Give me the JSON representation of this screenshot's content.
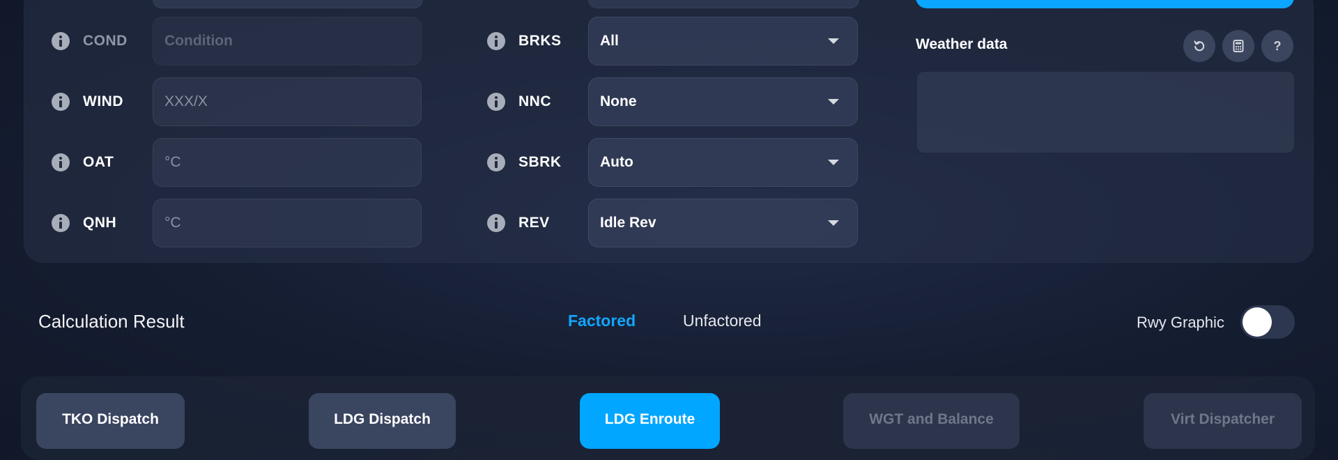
{
  "inputs": {
    "cond": {
      "label": "COND",
      "placeholder": "Condition"
    },
    "wind": {
      "label": "WIND",
      "placeholder": "XXX/X"
    },
    "oat": {
      "label": "OAT",
      "placeholder": "°C"
    },
    "qnh": {
      "label": "QNH",
      "placeholder": "°C"
    }
  },
  "selects": {
    "brks": {
      "label": "BRKS",
      "value": "All"
    },
    "nnc": {
      "label": "NNC",
      "value": "None"
    },
    "sbrk": {
      "label": "SBRK",
      "value": "Auto"
    },
    "rev": {
      "label": "REV",
      "value": "Idle Rev"
    }
  },
  "weather": {
    "title": "Weather data",
    "buttons": [
      "reset-icon",
      "calculator-icon",
      "help-icon"
    ],
    "help_glyph": "?"
  },
  "result": {
    "title": "Calculation Result",
    "tabs": [
      {
        "label": "Factored",
        "active": true
      },
      {
        "label": "Unfactored",
        "active": false
      }
    ],
    "rwy_graphic_label": "Rwy Graphic",
    "rwy_graphic_on": false
  },
  "nav": [
    {
      "label": "TKO Dispatch",
      "state": "normal"
    },
    {
      "label": "LDG Dispatch",
      "state": "normal"
    },
    {
      "label": "LDG Enroute",
      "state": "active"
    },
    {
      "label": "WGT and Balance",
      "state": "disabled"
    },
    {
      "label": "Virt Dispatcher",
      "state": "disabled"
    }
  ],
  "colors": {
    "accent": "#00a6ff",
    "background": "#151d31",
    "panel": "#283248"
  }
}
